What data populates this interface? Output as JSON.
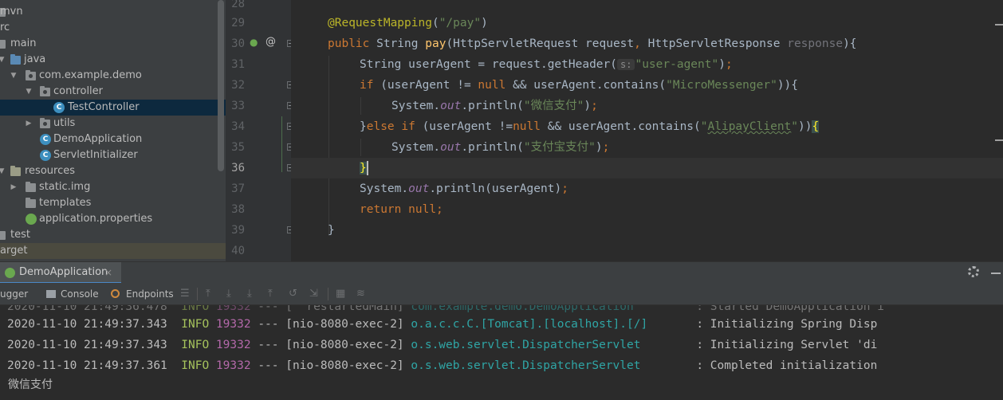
{
  "project": {
    "items": [
      {
        "label": "mvn",
        "icon": "folder-icon"
      },
      {
        "label": "rc",
        "icon": "folder-icon"
      },
      {
        "label": "main",
        "icon": "folder-icon"
      },
      {
        "label": "java",
        "icon": "source-folder-icon"
      },
      {
        "label": "com.example.demo",
        "icon": "package-icon"
      },
      {
        "label": "controller",
        "icon": "package-icon"
      },
      {
        "label": "TestController",
        "icon": "java-class-icon"
      },
      {
        "label": "utils",
        "icon": "package-icon"
      },
      {
        "label": "DemoApplication",
        "icon": "spring-boot-class-icon"
      },
      {
        "label": "ServletInitializer",
        "icon": "java-class-icon"
      },
      {
        "label": "resources",
        "icon": "resources-folder-icon"
      },
      {
        "label": "static.img",
        "icon": "folder-icon"
      },
      {
        "label": "templates",
        "icon": "folder-icon"
      },
      {
        "label": "application.properties",
        "icon": "spring-properties-icon"
      },
      {
        "label": "test",
        "icon": "folder-icon"
      },
      {
        "label": "arget",
        "icon": "folder-icon"
      }
    ],
    "selected": "TestController"
  },
  "editor": {
    "line_numbers": [
      "28",
      "29",
      "30",
      "31",
      "32",
      "33",
      "34",
      "35",
      "36",
      "37",
      "38",
      "39",
      "40"
    ],
    "current_line": "36",
    "code": {
      "l29_ann": "@RequestMapping",
      "l29_paren_open": "(",
      "l29_str": "\"/pay\"",
      "l29_paren_close": ")",
      "l30_public": "public",
      "l30_type": " String ",
      "l30_fn": "pay",
      "l30_params_a": "(HttpServletRequest request",
      "l30_comma": ", ",
      "l30_params_b": "HttpServletResponse ",
      "l30_response": "response",
      "l30_end": "){",
      "l31_a": "String userAgent = request.getHeader(",
      "l31_hint": "s:",
      "l31_str": "\"user-agent\"",
      "l31_end": ")",
      "l31_semi": ";",
      "l32_if": "if",
      "l32_a": " (userAgent != ",
      "l32_null": "null",
      "l32_b": " && userAgent.contains(",
      "l32_str": "\"MicroMessenger\"",
      "l32_end": ")){",
      "l33_a": "System.",
      "l33_out": "out",
      "l33_b": ".println(",
      "l33_str": "\"微信支付\"",
      "l33_end": ")",
      "l33_semi": ";",
      "l34_brace": "}",
      "l34_else": "else if",
      "l34_a": " (userAgent !=",
      "l34_null": "null",
      "l34_b": " && userAgent.contains(",
      "l34_str_q1": "\"",
      "l34_str_word": "AlipayClient",
      "l34_str_q2": "\"",
      "l34_close": "))",
      "l34_open": "{",
      "l35_a": "System.",
      "l35_out": "out",
      "l35_b": ".println(",
      "l35_str": "\"支付宝支付\"",
      "l35_end": ")",
      "l35_semi": ";",
      "l36_brace": "}",
      "l37_a": "System.",
      "l37_out": "out",
      "l37_b": ".println(userAgent)",
      "l37_semi": ";",
      "l38_return": "return",
      "l38_sp": " ",
      "l38_null": "null",
      "l38_semi": ";",
      "l39_brace": "}"
    }
  },
  "run": {
    "tab_label": "DemoApplication",
    "tab_close": "×",
    "toolbar": {
      "debugger": "ugger",
      "console": "Console",
      "endpoints": "Endpoints"
    },
    "logs": [
      {
        "time": "2020-11-10 21:49:37.343",
        "level": "INFO",
        "pid": "19332",
        "sep": "---",
        "thread": "[nio-8080-exec-2]",
        "logger": "o.a.c.c.C.[Tomcat].[localhost].[/]      ",
        "msg": ": Initializing Spring Disp"
      },
      {
        "time": "2020-11-10 21:49:37.343",
        "level": "INFO",
        "pid": "19332",
        "sep": "---",
        "thread": "[nio-8080-exec-2]",
        "logger": "o.s.web.servlet.DispatcherServlet       ",
        "msg": ": Initializing Servlet 'di"
      },
      {
        "time": "2020-11-10 21:49:37.361",
        "level": "INFO",
        "pid": "19332",
        "sep": "---",
        "thread": "[nio-8080-exec-2]",
        "logger": "o.s.web.servlet.DispatcherServlet       ",
        "msg": ": Completed initialization"
      }
    ],
    "output": "微信支付"
  },
  "colors": {
    "keyword": "#cc7832",
    "string": "#6a8759",
    "annotation": "#bbb529",
    "method": "#ffc66d",
    "selection": "#0d293e"
  }
}
